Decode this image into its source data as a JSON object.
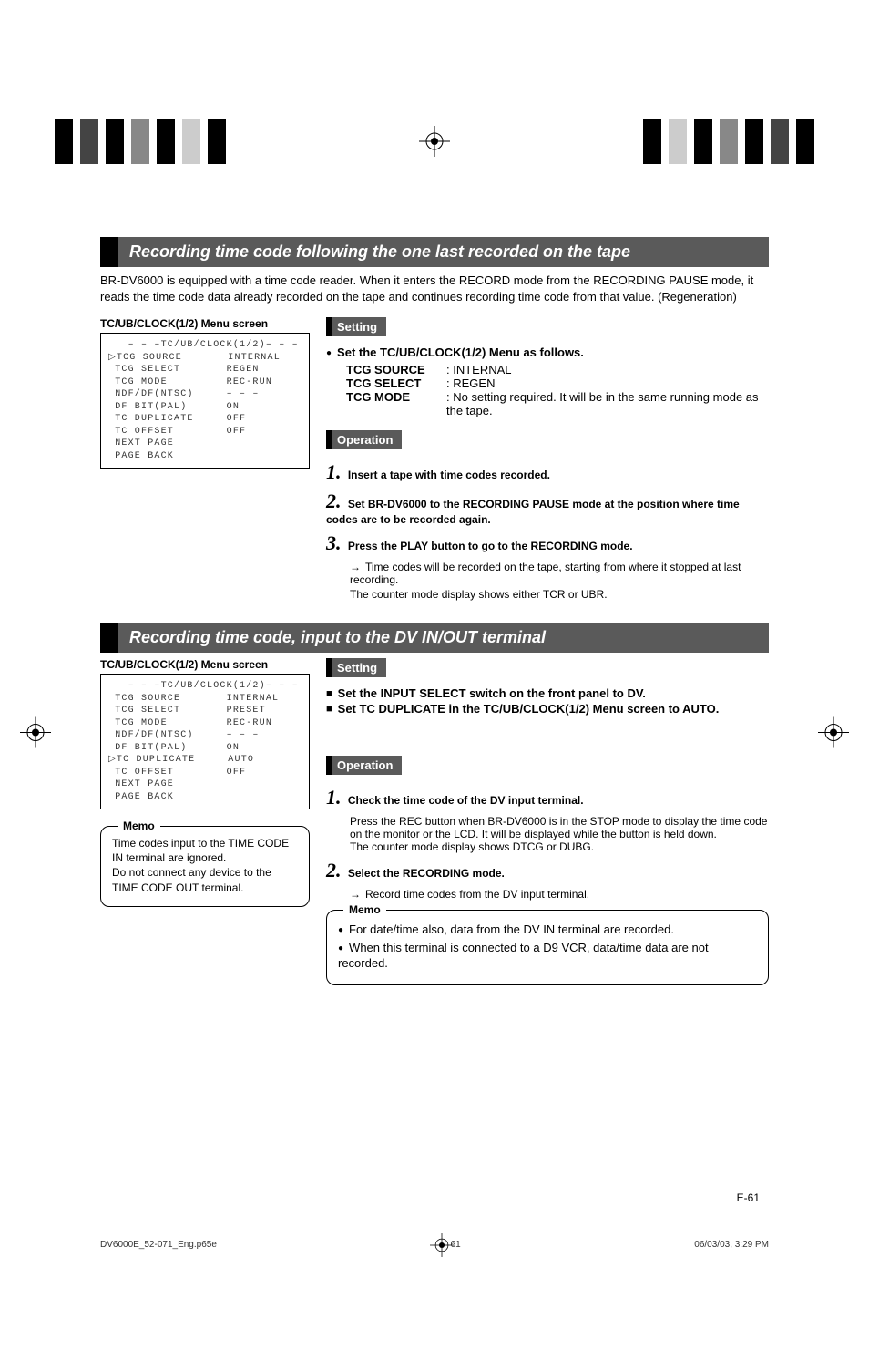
{
  "section1": {
    "title": "Recording time code following the one last recorded on the tape",
    "lead": "BR-DV6000 is equipped with a time code reader. When it enters the RECORD mode from the RECORDING PAUSE mode, it reads the time code data already recorded on the tape and continues recording time code from that value. (Regeneration)",
    "screen_caption": "TC/UB/CLOCK(1/2) Menu screen",
    "screen_title": "– – –TC/UB/CLOCK(1/2)– – –",
    "screen_rows": [
      [
        "▷TCG SOURCE",
        "INTERNAL"
      ],
      [
        " TCG SELECT",
        "REGEN"
      ],
      [
        " TCG MODE",
        "REC-RUN"
      ],
      [
        " NDF/DF(NTSC)",
        "– – –"
      ],
      [
        " DF BIT(PAL)",
        "ON"
      ],
      [
        " TC DUPLICATE",
        "OFF"
      ],
      [
        " TC OFFSET",
        "OFF"
      ],
      [
        " NEXT PAGE",
        ""
      ],
      [
        " PAGE BACK",
        ""
      ]
    ],
    "setting_label": "Setting",
    "setting_head": "Set the TC/UB/CLOCK(1/2) Menu as follows.",
    "settings": [
      {
        "k": "TCG SOURCE",
        "v": ": INTERNAL"
      },
      {
        "k": "TCG SELECT",
        "v": ": REGEN"
      },
      {
        "k": "TCG MODE",
        "v": ": No setting required. It will be in the same running mode as the tape."
      }
    ],
    "operation_label": "Operation",
    "steps": [
      {
        "n": "1.",
        "head": "Insert a tape with time codes recorded."
      },
      {
        "n": "2.",
        "head": "Set BR-DV6000 to the RECORDING PAUSE mode at the position where time codes are to be recorded again."
      },
      {
        "n": "3.",
        "head": "Press the PLAY button to go to the RECORDING mode.",
        "sub": [
          "Time codes will be recorded on the tape, starting from where it stopped at last recording.",
          "The counter mode display shows either TCR or UBR."
        ]
      }
    ]
  },
  "section2": {
    "title": "Recording time code, input to the DV IN/OUT terminal",
    "screen_caption": "TC/UB/CLOCK(1/2) Menu screen",
    "screen_title": "– – –TC/UB/CLOCK(1/2)– – –",
    "screen_rows": [
      [
        " TCG SOURCE",
        "INTERNAL"
      ],
      [
        " TCG SELECT",
        "PRESET"
      ],
      [
        " TCG MODE",
        "REC-RUN"
      ],
      [
        " NDF/DF(NTSC)",
        "– – –"
      ],
      [
        " DF BIT(PAL)",
        "ON"
      ],
      [
        "▷TC DUPLICATE",
        "AUTO"
      ],
      [
        " TC OFFSET",
        "OFF"
      ],
      [
        " NEXT PAGE",
        ""
      ],
      [
        " PAGE BACK",
        ""
      ]
    ],
    "setting_label": "Setting",
    "setting_items": [
      "Set the INPUT SELECT switch on the front panel to DV.",
      "Set TC DUPLICATE in the TC/UB/CLOCK(1/2) Menu screen to AUTO."
    ],
    "memo_label": "Memo",
    "memo_text": "Time codes input to the TIME CODE IN terminal are ignored.\nDo not connect any device to the TIME CODE OUT terminal.",
    "operation_label": "Operation",
    "steps": [
      {
        "n": "1.",
        "head": "Check the time code of the DV input terminal.",
        "body": "Press the REC button when BR-DV6000 is in the STOP mode to display the time code on the monitor or the LCD. It will be displayed while the button is held down.\nThe counter mode display shows DTCG or DUBG."
      },
      {
        "n": "2.",
        "head": "Select the RECORDING mode.",
        "sub": [
          "Record time codes from the DV input terminal."
        ]
      }
    ],
    "memo2_label": "Memo",
    "memo2_items": [
      "For date/time also, data from the DV IN terminal are recorded.",
      "When this terminal is connected to a D9 VCR, data/time data are not recorded."
    ]
  },
  "page_num": "E-61",
  "footer": {
    "file": "DV6000E_52-071_Eng.p65e",
    "page": "61",
    "date": "06/03/03, 3:29 PM"
  }
}
